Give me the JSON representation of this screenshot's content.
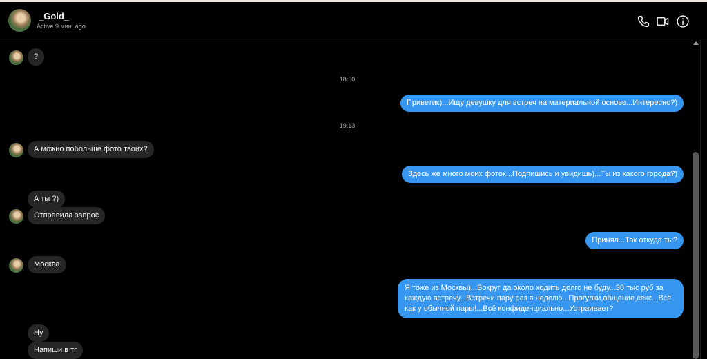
{
  "header": {
    "username": "_Gold_",
    "status": "Active 9 мин. ago",
    "icons": [
      "phone-icon",
      "video-camera-icon",
      "info-icon"
    ]
  },
  "messages": [
    {
      "side": "in",
      "text": "?",
      "avatar": true
    },
    {
      "side": "time",
      "text": "18:50"
    },
    {
      "side": "out",
      "text": "Приветик)...Ищу девушку для встреч на материальной основе...Интересно?)"
    },
    {
      "side": "time",
      "text": "19:13"
    },
    {
      "side": "in",
      "text": "А можно побольше фото твоих?",
      "avatar": true
    },
    {
      "side": "out",
      "text": "Здесь же много моих фоток...Подпишись и увидишь)...Ты из какого города?)"
    },
    {
      "side": "in",
      "text": "А ты ?)",
      "avatar": false
    },
    {
      "side": "in",
      "text": "Отправила запрос",
      "avatar": true
    },
    {
      "side": "out",
      "text": "Принял...Так откуда ты?"
    },
    {
      "side": "in",
      "text": "Москва",
      "avatar": true
    },
    {
      "side": "out",
      "text": "Я тоже из Москвы)...Вокруг да около ходить долго не буду...30 тыс руб за каждую встречу...Встречи пару раз в неделю...Прогулки,общение,секс...Всё как у обычной пары!...Всё конфиденциально...Устраивает?"
    },
    {
      "side": "in",
      "text": "Ну",
      "avatar": false
    },
    {
      "side": "in",
      "text": "Напиши в тг",
      "avatar": false
    }
  ],
  "colors": {
    "background": "#000000",
    "incoming_bubble": "#262626",
    "outgoing_bubble": "#3797f0",
    "secondary_text": "#a8a8a8"
  }
}
